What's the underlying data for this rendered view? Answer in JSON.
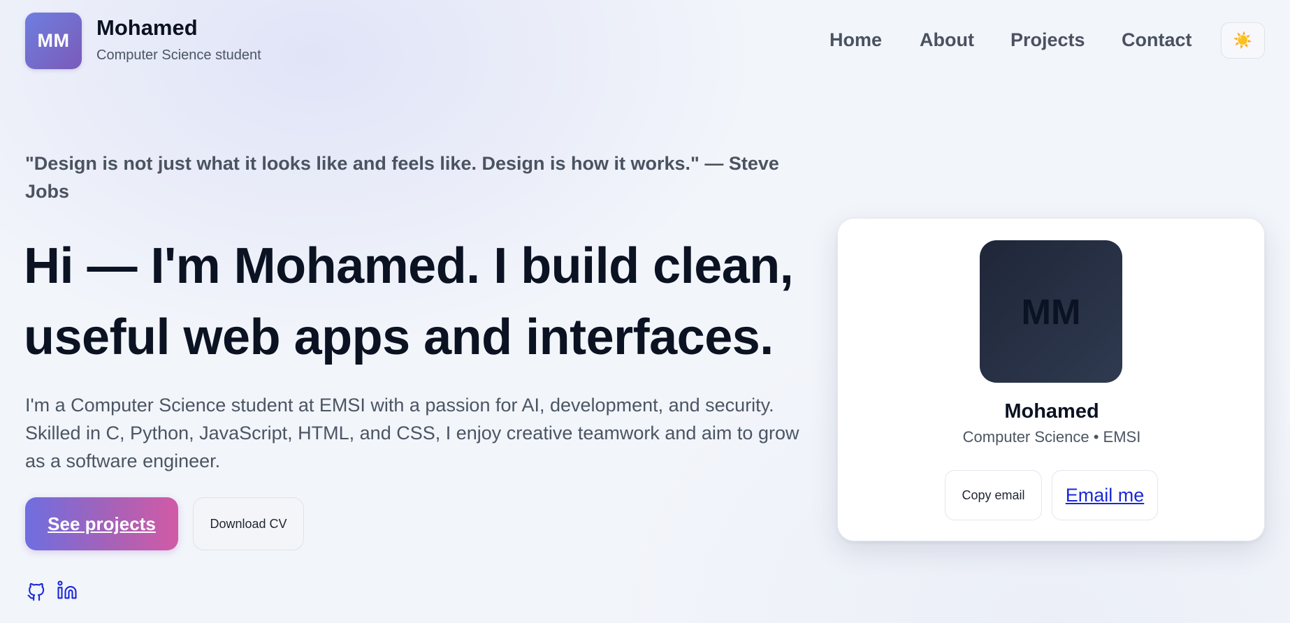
{
  "header": {
    "logo_initials": "MM",
    "name": "Mohamed",
    "subtitle": "Computer Science student",
    "nav": [
      {
        "label": "Home"
      },
      {
        "label": "About"
      },
      {
        "label": "Projects"
      },
      {
        "label": "Contact"
      }
    ],
    "theme_toggle_icon": "☀️"
  },
  "hero": {
    "quote": "\"Design is not just what it looks like and feels like. Design is how it works.\" — Steve Jobs",
    "headline": "Hi — I'm Mohamed. I build clean, useful web apps and interfaces.",
    "bio": "I'm a Computer Science student at EMSI with a passion for AI, development, and security. Skilled in C, Python, JavaScript, HTML, and CSS, I enjoy creative teamwork and aim to grow as a software engineer.",
    "primary_button": "See projects",
    "secondary_button": "Download CV",
    "social": [
      {
        "icon": "github-icon"
      },
      {
        "icon": "linkedin-icon"
      }
    ]
  },
  "card": {
    "avatar_initials": "MM",
    "name": "Mohamed",
    "subtitle": "Computer Science • EMSI",
    "copy_email_button": "Copy email",
    "email_button": "Email me"
  },
  "colors": {
    "accent_gradient_start": "#6f6ee0",
    "accent_gradient_end": "#d25aa5",
    "link_blue": "#1a28d9",
    "text_dark": "#0b1222"
  }
}
